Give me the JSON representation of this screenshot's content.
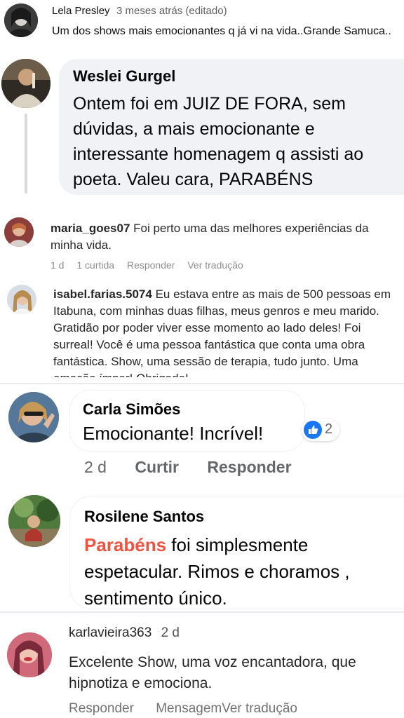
{
  "comments": [
    {
      "author": "Lela Presley",
      "meta": "3 meses atrás (editado)",
      "text": "Um dos shows mais emocionantes q já vi na vida..Grande Samuca.."
    },
    {
      "author": "Weslei Gurgel",
      "lines": [
        "Ontem foi em JUIZ DE FORA, sem",
        "dúvidas, a mais emocionante e",
        "interessante homenagem q assisti ao",
        "poeta. Valeu cara, PARABÉNS"
      ]
    },
    {
      "author": "maria_goes07",
      "text_first": "Foi perto uma das melhores experiências da",
      "text_second": "minha vida.",
      "actions": {
        "time": "1 d",
        "likes": "1 curtida",
        "reply": "Responder",
        "translate": "Ver tradução"
      }
    },
    {
      "author": "isabel.farias.5074",
      "text_first": "Eu estava entre as mais de 500 pessoas em",
      "lines": [
        "Itabuna, com minhas duas filhas, meus genros e meu marido.",
        "Gratidão por poder viver esse momento ao lado deles! Foi",
        "surreal! Você é uma pessoa fantástica que conta uma obra",
        "fantástica. Show, uma sessão de terapia, tudo junto. Uma",
        "emoção ímpar! Obrigada!"
      ]
    },
    {
      "author": "Carla Simões",
      "text": "Emocionante! Incrível!",
      "reaction_count": "2",
      "reaction_icon": "thumbs-up-icon",
      "actions": {
        "time": "2 d",
        "like": "Curtir",
        "reply": "Responder"
      }
    },
    {
      "author": "Rosilene Santos",
      "highlight": "Parabéns",
      "text_first": " foi simplesmente",
      "lines": [
        "espetacular. Rimos e choramos ,",
        "sentimento único."
      ]
    },
    {
      "author": "karlavieira363",
      "time": "2 d",
      "lines": [
        "Excelente Show, uma voz encantadora, que",
        "hipnotiza e emociona."
      ],
      "actions": {
        "reply": "Responder",
        "message": "Mensagem",
        "translate": "Ver tradução"
      }
    }
  ],
  "colors": {
    "facebook_blue": "#1877f2",
    "highlight_red": "#f0533f",
    "bubble_gray": "#f0f2f5",
    "meta_gray": "#65676b"
  }
}
